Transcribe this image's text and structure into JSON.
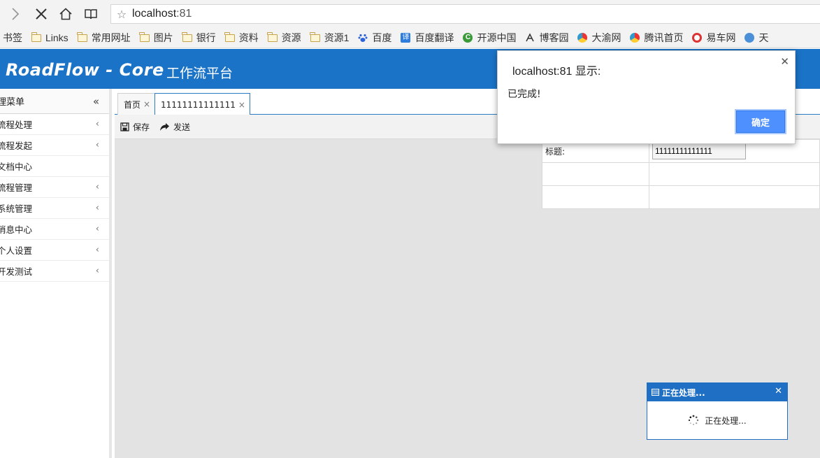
{
  "browser": {
    "url_host": "localhost",
    "url_port": ":81"
  },
  "bookmarks": [
    {
      "label": "书签",
      "icon": "none"
    },
    {
      "label": "Links",
      "icon": "folder-icon"
    },
    {
      "label": "常用网址",
      "icon": "folder-icon"
    },
    {
      "label": "图片",
      "icon": "folder-icon"
    },
    {
      "label": "银行",
      "icon": "folder-icon"
    },
    {
      "label": "资料",
      "icon": "folder-icon"
    },
    {
      "label": "资源",
      "icon": "folder-icon"
    },
    {
      "label": "资源1",
      "icon": "folder-icon"
    },
    {
      "label": "百度",
      "icon": "baidu-icon"
    },
    {
      "label": "百度翻译",
      "icon": "translate-icon"
    },
    {
      "label": "开源中国",
      "icon": "oschina-icon"
    },
    {
      "label": "博客园",
      "icon": "cnblogs-icon"
    },
    {
      "label": "大渝网",
      "icon": "site-icon"
    },
    {
      "label": "腾讯首页",
      "icon": "site-icon"
    },
    {
      "label": "易车网",
      "icon": "yiche-icon"
    },
    {
      "label": "天",
      "icon": "globe-icon"
    }
  ],
  "app": {
    "logo": "RoadFlow - Core",
    "subtitle": "工作流平台"
  },
  "sidebar": {
    "title": "理菜单",
    "items": [
      {
        "label": "流程处理",
        "has_children": true
      },
      {
        "label": "流程发起",
        "has_children": true
      },
      {
        "label": "文档中心",
        "has_children": false
      },
      {
        "label": "流程管理",
        "has_children": true
      },
      {
        "label": "系统管理",
        "has_children": true
      },
      {
        "label": "消息中心",
        "has_children": true
      },
      {
        "label": "个人设置",
        "has_children": true
      },
      {
        "label": "开发测试",
        "has_children": true
      }
    ]
  },
  "tabs": [
    {
      "label": "首页",
      "active": false
    },
    {
      "label": "11111111111111",
      "active": true
    }
  ],
  "toolbar": {
    "save_label": "保存",
    "send_label": "发送"
  },
  "form": {
    "title_label": "标题:",
    "title_value": "11111111111111"
  },
  "alert": {
    "title": "localhost:81 显示:",
    "message": "已完成!",
    "ok_label": "确定"
  },
  "processing": {
    "title": "正在处理...",
    "message": "正在处理..."
  },
  "colors": {
    "header_blue": "#1a73c7",
    "tab_border": "#2b7cc4",
    "ok_button": "#4d90fe"
  }
}
